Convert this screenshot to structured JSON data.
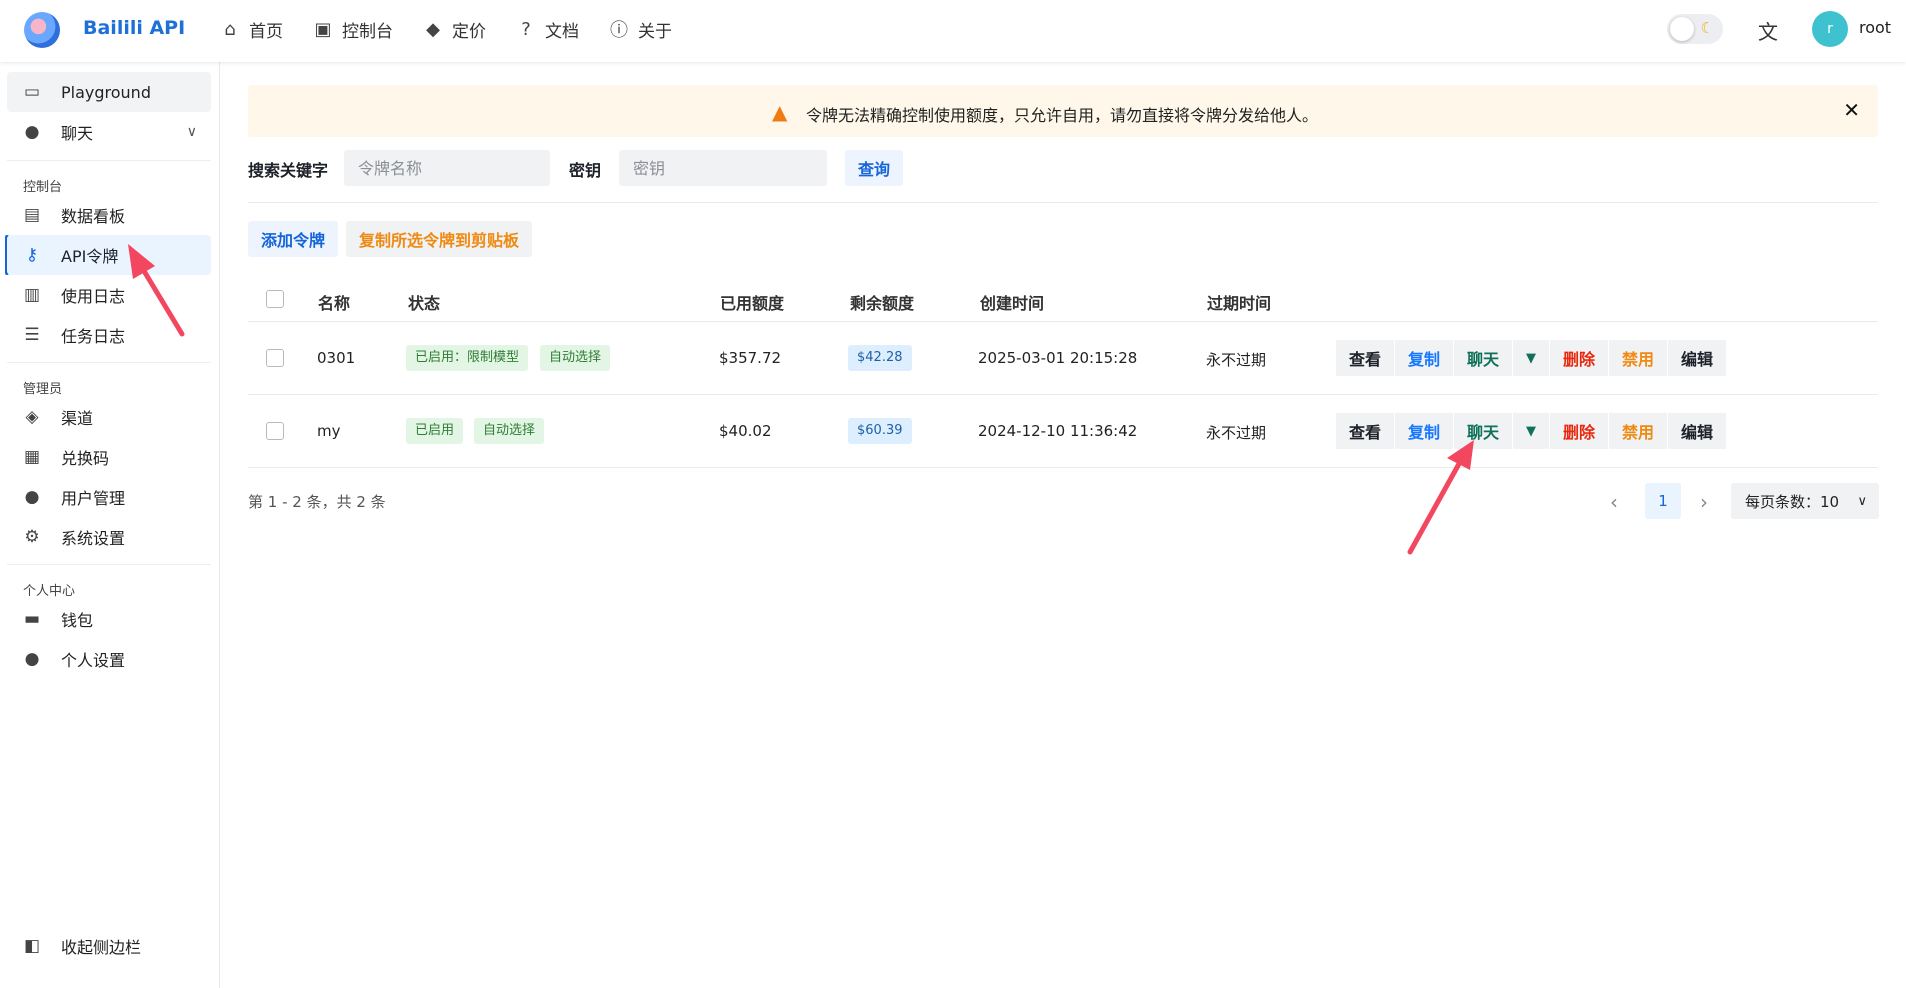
{
  "header": {
    "app_title": "Bailili API",
    "nav": [
      {
        "label": "首页",
        "icon": "home-icon"
      },
      {
        "label": "控制台",
        "icon": "terminal-icon"
      },
      {
        "label": "定价",
        "icon": "tag-icon"
      },
      {
        "label": "文档",
        "icon": "help-icon"
      },
      {
        "label": "关于",
        "icon": "info-icon"
      }
    ],
    "avatar_letter": "r",
    "username": "root"
  },
  "sidebar": {
    "playground": "Playground",
    "chat": "聊天",
    "group_console": "控制台",
    "dashboard": "数据看板",
    "api_tokens": "API令牌",
    "usage_log": "使用日志",
    "task_log": "任务日志",
    "group_admin": "管理员",
    "channels": "渠道",
    "redeem_codes": "兑换码",
    "user_mgmt": "用户管理",
    "system_settings": "系统设置",
    "group_personal": "个人中心",
    "wallet": "钱包",
    "personal_settings": "个人设置",
    "collapse": "收起侧边栏"
  },
  "alert": {
    "text": "令牌无法精确控制使用额度，只允许自用，请勿直接将令牌分发给他人。"
  },
  "search": {
    "keyword_label": "搜索关键字",
    "name_placeholder": "令牌名称",
    "key_label": "密钥",
    "key_placeholder": "密钥",
    "query_button": "查询"
  },
  "toolbar": {
    "add_token": "添加令牌",
    "copy_selected": "复制所选令牌到剪贴板"
  },
  "table": {
    "headers": {
      "name": "名称",
      "status": "状态",
      "used_quota": "已用额度",
      "remaining_quota": "剩余额度",
      "created_time": "创建时间",
      "expire_time": "过期时间"
    },
    "rows": [
      {
        "name": "0301",
        "status_tag": "已启用：限制模型",
        "group_tag": "自动选择",
        "used": "$357.72",
        "remaining": "$42.28",
        "created": "2025-03-01 20:15:28",
        "expires": "永不过期"
      },
      {
        "name": "my",
        "status_tag": "已启用",
        "group_tag": "自动选择",
        "used": "$40.02",
        "remaining": "$60.39",
        "created": "2024-12-10 11:36:42",
        "expires": "永不过期"
      }
    ],
    "actions": {
      "view": "查看",
      "copy": "复制",
      "chat": "聊天",
      "delete": "删除",
      "disable": "禁用",
      "edit": "编辑"
    }
  },
  "pagination": {
    "summary": "第 1 - 2 条，共 2 条",
    "current_page": "1",
    "page_size": "每页条数：10"
  },
  "colors": {
    "primary": "#1565d8",
    "annotation_arrow": "#f2475e",
    "alert_bg": "#fff8ea",
    "tag_green_bg": "#e3f6e6",
    "tag_blue_bg": "#ddeefe"
  }
}
